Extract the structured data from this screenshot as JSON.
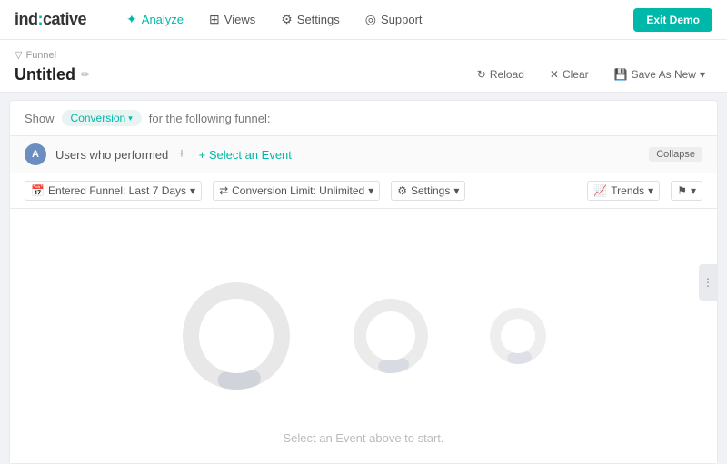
{
  "brand": {
    "name_part1": "ind",
    "name_accent": ":",
    "name_part2": "cative"
  },
  "navbar": {
    "logo": "ind:cative",
    "items": [
      {
        "label": "Analyze",
        "icon": "✦",
        "active": true
      },
      {
        "label": "Views",
        "icon": "⊞"
      },
      {
        "label": "Settings",
        "icon": "⚙"
      },
      {
        "label": "Support",
        "icon": "◎"
      }
    ],
    "exit_demo_label": "Exit Demo"
  },
  "breadcrumb": {
    "icon": "▽",
    "label": "Funnel"
  },
  "page": {
    "title": "Untitled",
    "edit_icon": "✏"
  },
  "header_actions": {
    "reload": "Reload",
    "clear": "Clear",
    "save_as_new": "Save As New"
  },
  "show_bar": {
    "show_label": "Show",
    "conversion_label": "Conversion",
    "following_label": "for the following funnel:"
  },
  "users_row": {
    "avatar_letter": "A",
    "users_text": "Users who performed",
    "select_event_link": "+ Select an Event",
    "collapse_label": "Collapse"
  },
  "controls": {
    "entered_funnel": "Entered Funnel: Last 7 Days",
    "conversion_limit": "Conversion Limit: Unlimited",
    "settings": "Settings",
    "trends": "Trends",
    "flag": "⚑"
  },
  "chart": {
    "empty_message": "Select an Event above to start."
  }
}
